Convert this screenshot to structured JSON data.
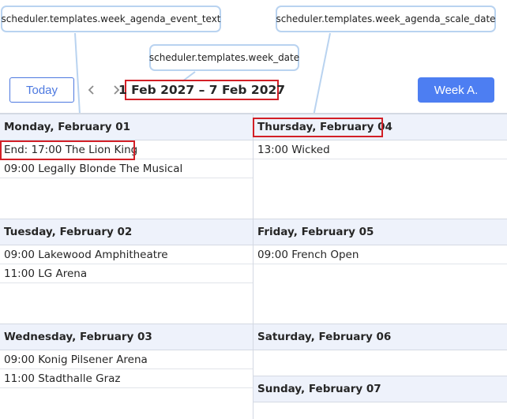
{
  "callouts": {
    "event_text": "scheduler.templates.week_agenda_event_text",
    "scale_date": "scheduler.templates.week_agenda_scale_date",
    "week_date": "scheduler.templates.week_date"
  },
  "toolbar": {
    "today_label": "Today",
    "date_range": "1 Feb 2027 – 7 Feb 2027",
    "view_label": "Week A."
  },
  "colors": {
    "accent": "#4d7ef2",
    "highlight": "#d21f26",
    "header_bg": "#eef2fb",
    "callout_border": "#b9d3f0"
  },
  "days": [
    {
      "label": "Monday, February 01",
      "events": [
        "End: 17:00 The Lion King",
        "09:00 Legally Blonde The Musical"
      ]
    },
    {
      "label": "Tuesday, February 02",
      "events": [
        "09:00 Lakewood Amphitheatre",
        "11:00 LG Arena"
      ]
    },
    {
      "label": "Wednesday, February 03",
      "events": [
        "09:00 Konig Pilsener Arena",
        "11:00 Stadthalle Graz"
      ]
    },
    {
      "label": "Thursday, February 04",
      "events": [
        "13:00 Wicked"
      ]
    },
    {
      "label": "Friday, February 05",
      "events": [
        "09:00 French Open"
      ]
    },
    {
      "label": "Saturday, February 06",
      "events": []
    },
    {
      "label": "Sunday, February 07",
      "events": []
    }
  ]
}
